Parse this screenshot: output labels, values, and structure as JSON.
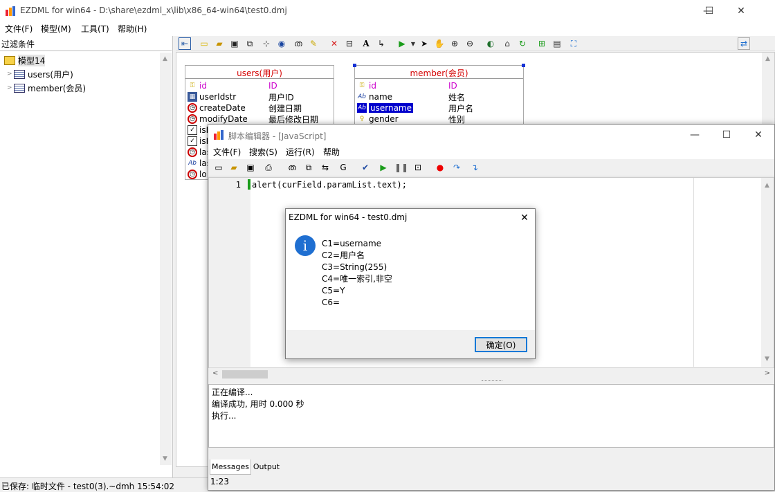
{
  "window": {
    "title": "EZDML for win64 - D:\\share\\ezdml_x\\lib\\x86_64-win64\\test0.dmj",
    "controls": {
      "minimize": "—",
      "maximize": "☐",
      "close": "✕"
    }
  },
  "menu": [
    "文件(F)",
    "模型(M)",
    "工具(T)",
    "帮助(H)"
  ],
  "left_panel": {
    "filter_label": "过滤条件",
    "tree": {
      "root": "模型14",
      "items": [
        "users(用户)",
        "member(会员)"
      ]
    }
  },
  "entities": {
    "users": {
      "title": "users(用户)",
      "fields": [
        {
          "name": "id",
          "label": "ID",
          "icon": "key-icon",
          "pk": true
        },
        {
          "name": "userIdstr",
          "label": "用户ID",
          "icon": "calculator-icon",
          "pk": false
        },
        {
          "name": "createDate",
          "label": "创建日期",
          "icon": "clock-icon",
          "pk": false
        },
        {
          "name": "modifyDate",
          "label": "最后修改日期",
          "icon": "clock-icon",
          "pk": false
        },
        {
          "name": "isE",
          "label": "",
          "icon": "checkbox-icon",
          "pk": false
        },
        {
          "name": "isL",
          "label": "",
          "icon": "checkbox-icon",
          "pk": false
        },
        {
          "name": "las",
          "label": "",
          "icon": "clock-icon",
          "pk": false
        },
        {
          "name": "las",
          "label": "",
          "icon": "string-icon",
          "pk": false
        },
        {
          "name": "lo",
          "label": "",
          "icon": "clock-icon",
          "pk": false
        }
      ]
    },
    "member": {
      "title": "member(会员)",
      "fields": [
        {
          "name": "id",
          "label": "ID",
          "icon": "key-icon",
          "pk": true
        },
        {
          "name": "name",
          "label": "姓名",
          "icon": "string-icon",
          "pk": false
        },
        {
          "name": "username",
          "label": "用户名",
          "icon": "string-icon",
          "pk": false,
          "selected": true
        },
        {
          "name": "gender",
          "label": "性别",
          "icon": "bulb-icon",
          "pk": false
        }
      ]
    }
  },
  "status": "已保存: 临时文件 - test0(3).~dmh 15:54:02",
  "editor": {
    "title": "脚本编辑器 - [JavaScript]",
    "menu": [
      "文件(F)",
      "搜索(S)",
      "运行(R)",
      "帮助"
    ],
    "line_number": "1",
    "code": "alert(curField.paramList.text);",
    "messages": [
      "正在编译...",
      "编译成功, 用时 0.000 秒",
      "执行..."
    ],
    "tabs": [
      "Messages",
      "Output"
    ],
    "cursor": "1:23"
  },
  "dialog": {
    "title": "EZDML for win64 - test0.dmj",
    "lines": [
      "C1=username",
      "C2=用户名",
      "C3=String(255)",
      "C4=唯一索引,非空",
      "C5=Y",
      "C6="
    ],
    "ok_label": "确定(O)",
    "close": "✕",
    "info_glyph": "i"
  },
  "colors": {
    "entity_title": "#d40000",
    "primary_key": "#cc00cc",
    "selection": "#0000cc",
    "run_green": "#1a9c1a"
  }
}
